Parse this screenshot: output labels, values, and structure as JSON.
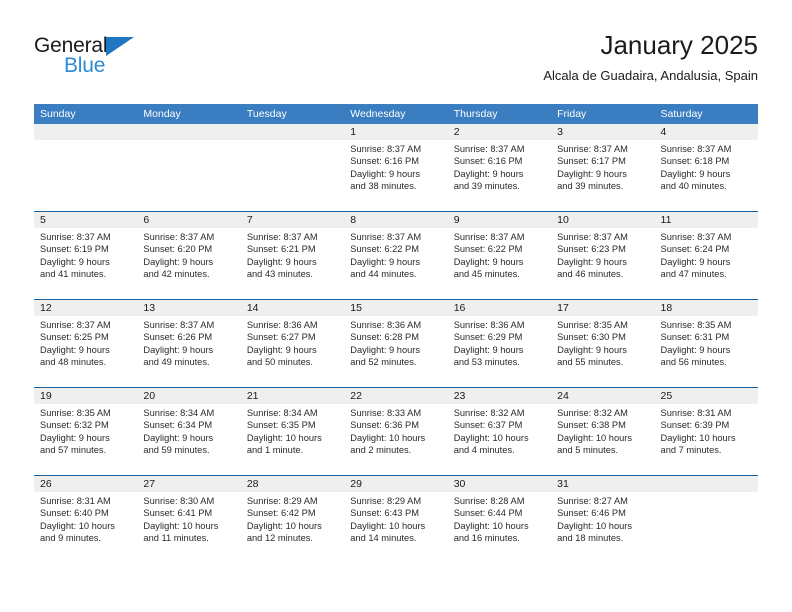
{
  "brand": {
    "name_top": "General",
    "name_bottom": "Blue",
    "accent_color": "#2b8bd4",
    "triangle_color": "#1f77c4"
  },
  "header": {
    "title": "January 2025",
    "subtitle": "Alcala de Guadaira, Andalusia, Spain"
  },
  "calendar": {
    "header_bg": "#3a7dc0",
    "week_divider_color": "#16619e",
    "daynum_bg": "#efefef",
    "weekdays": [
      "Sunday",
      "Monday",
      "Tuesday",
      "Wednesday",
      "Thursday",
      "Friday",
      "Saturday"
    ],
    "weeks": [
      [
        {
          "day": "",
          "empty": true
        },
        {
          "day": "",
          "empty": true
        },
        {
          "day": "",
          "empty": true
        },
        {
          "day": "1",
          "sunrise": "Sunrise: 8:37 AM",
          "sunset": "Sunset: 6:16 PM",
          "daylight1": "Daylight: 9 hours",
          "daylight2": "and 38 minutes."
        },
        {
          "day": "2",
          "sunrise": "Sunrise: 8:37 AM",
          "sunset": "Sunset: 6:16 PM",
          "daylight1": "Daylight: 9 hours",
          "daylight2": "and 39 minutes."
        },
        {
          "day": "3",
          "sunrise": "Sunrise: 8:37 AM",
          "sunset": "Sunset: 6:17 PM",
          "daylight1": "Daylight: 9 hours",
          "daylight2": "and 39 minutes."
        },
        {
          "day": "4",
          "sunrise": "Sunrise: 8:37 AM",
          "sunset": "Sunset: 6:18 PM",
          "daylight1": "Daylight: 9 hours",
          "daylight2": "and 40 minutes."
        }
      ],
      [
        {
          "day": "5",
          "sunrise": "Sunrise: 8:37 AM",
          "sunset": "Sunset: 6:19 PM",
          "daylight1": "Daylight: 9 hours",
          "daylight2": "and 41 minutes."
        },
        {
          "day": "6",
          "sunrise": "Sunrise: 8:37 AM",
          "sunset": "Sunset: 6:20 PM",
          "daylight1": "Daylight: 9 hours",
          "daylight2": "and 42 minutes."
        },
        {
          "day": "7",
          "sunrise": "Sunrise: 8:37 AM",
          "sunset": "Sunset: 6:21 PM",
          "daylight1": "Daylight: 9 hours",
          "daylight2": "and 43 minutes."
        },
        {
          "day": "8",
          "sunrise": "Sunrise: 8:37 AM",
          "sunset": "Sunset: 6:22 PM",
          "daylight1": "Daylight: 9 hours",
          "daylight2": "and 44 minutes."
        },
        {
          "day": "9",
          "sunrise": "Sunrise: 8:37 AM",
          "sunset": "Sunset: 6:22 PM",
          "daylight1": "Daylight: 9 hours",
          "daylight2": "and 45 minutes."
        },
        {
          "day": "10",
          "sunrise": "Sunrise: 8:37 AM",
          "sunset": "Sunset: 6:23 PM",
          "daylight1": "Daylight: 9 hours",
          "daylight2": "and 46 minutes."
        },
        {
          "day": "11",
          "sunrise": "Sunrise: 8:37 AM",
          "sunset": "Sunset: 6:24 PM",
          "daylight1": "Daylight: 9 hours",
          "daylight2": "and 47 minutes."
        }
      ],
      [
        {
          "day": "12",
          "sunrise": "Sunrise: 8:37 AM",
          "sunset": "Sunset: 6:25 PM",
          "daylight1": "Daylight: 9 hours",
          "daylight2": "and 48 minutes."
        },
        {
          "day": "13",
          "sunrise": "Sunrise: 8:37 AM",
          "sunset": "Sunset: 6:26 PM",
          "daylight1": "Daylight: 9 hours",
          "daylight2": "and 49 minutes."
        },
        {
          "day": "14",
          "sunrise": "Sunrise: 8:36 AM",
          "sunset": "Sunset: 6:27 PM",
          "daylight1": "Daylight: 9 hours",
          "daylight2": "and 50 minutes."
        },
        {
          "day": "15",
          "sunrise": "Sunrise: 8:36 AM",
          "sunset": "Sunset: 6:28 PM",
          "daylight1": "Daylight: 9 hours",
          "daylight2": "and 52 minutes."
        },
        {
          "day": "16",
          "sunrise": "Sunrise: 8:36 AM",
          "sunset": "Sunset: 6:29 PM",
          "daylight1": "Daylight: 9 hours",
          "daylight2": "and 53 minutes."
        },
        {
          "day": "17",
          "sunrise": "Sunrise: 8:35 AM",
          "sunset": "Sunset: 6:30 PM",
          "daylight1": "Daylight: 9 hours",
          "daylight2": "and 55 minutes."
        },
        {
          "day": "18",
          "sunrise": "Sunrise: 8:35 AM",
          "sunset": "Sunset: 6:31 PM",
          "daylight1": "Daylight: 9 hours",
          "daylight2": "and 56 minutes."
        }
      ],
      [
        {
          "day": "19",
          "sunrise": "Sunrise: 8:35 AM",
          "sunset": "Sunset: 6:32 PM",
          "daylight1": "Daylight: 9 hours",
          "daylight2": "and 57 minutes."
        },
        {
          "day": "20",
          "sunrise": "Sunrise: 8:34 AM",
          "sunset": "Sunset: 6:34 PM",
          "daylight1": "Daylight: 9 hours",
          "daylight2": "and 59 minutes."
        },
        {
          "day": "21",
          "sunrise": "Sunrise: 8:34 AM",
          "sunset": "Sunset: 6:35 PM",
          "daylight1": "Daylight: 10 hours",
          "daylight2": "and 1 minute."
        },
        {
          "day": "22",
          "sunrise": "Sunrise: 8:33 AM",
          "sunset": "Sunset: 6:36 PM",
          "daylight1": "Daylight: 10 hours",
          "daylight2": "and 2 minutes."
        },
        {
          "day": "23",
          "sunrise": "Sunrise: 8:32 AM",
          "sunset": "Sunset: 6:37 PM",
          "daylight1": "Daylight: 10 hours",
          "daylight2": "and 4 minutes."
        },
        {
          "day": "24",
          "sunrise": "Sunrise: 8:32 AM",
          "sunset": "Sunset: 6:38 PM",
          "daylight1": "Daylight: 10 hours",
          "daylight2": "and 5 minutes."
        },
        {
          "day": "25",
          "sunrise": "Sunrise: 8:31 AM",
          "sunset": "Sunset: 6:39 PM",
          "daylight1": "Daylight: 10 hours",
          "daylight2": "and 7 minutes."
        }
      ],
      [
        {
          "day": "26",
          "sunrise": "Sunrise: 8:31 AM",
          "sunset": "Sunset: 6:40 PM",
          "daylight1": "Daylight: 10 hours",
          "daylight2": "and 9 minutes."
        },
        {
          "day": "27",
          "sunrise": "Sunrise: 8:30 AM",
          "sunset": "Sunset: 6:41 PM",
          "daylight1": "Daylight: 10 hours",
          "daylight2": "and 11 minutes."
        },
        {
          "day": "28",
          "sunrise": "Sunrise: 8:29 AM",
          "sunset": "Sunset: 6:42 PM",
          "daylight1": "Daylight: 10 hours",
          "daylight2": "and 12 minutes."
        },
        {
          "day": "29",
          "sunrise": "Sunrise: 8:29 AM",
          "sunset": "Sunset: 6:43 PM",
          "daylight1": "Daylight: 10 hours",
          "daylight2": "and 14 minutes."
        },
        {
          "day": "30",
          "sunrise": "Sunrise: 8:28 AM",
          "sunset": "Sunset: 6:44 PM",
          "daylight1": "Daylight: 10 hours",
          "daylight2": "and 16 minutes."
        },
        {
          "day": "31",
          "sunrise": "Sunrise: 8:27 AM",
          "sunset": "Sunset: 6:46 PM",
          "daylight1": "Daylight: 10 hours",
          "daylight2": "and 18 minutes."
        },
        {
          "day": "",
          "empty": true
        }
      ]
    ]
  }
}
